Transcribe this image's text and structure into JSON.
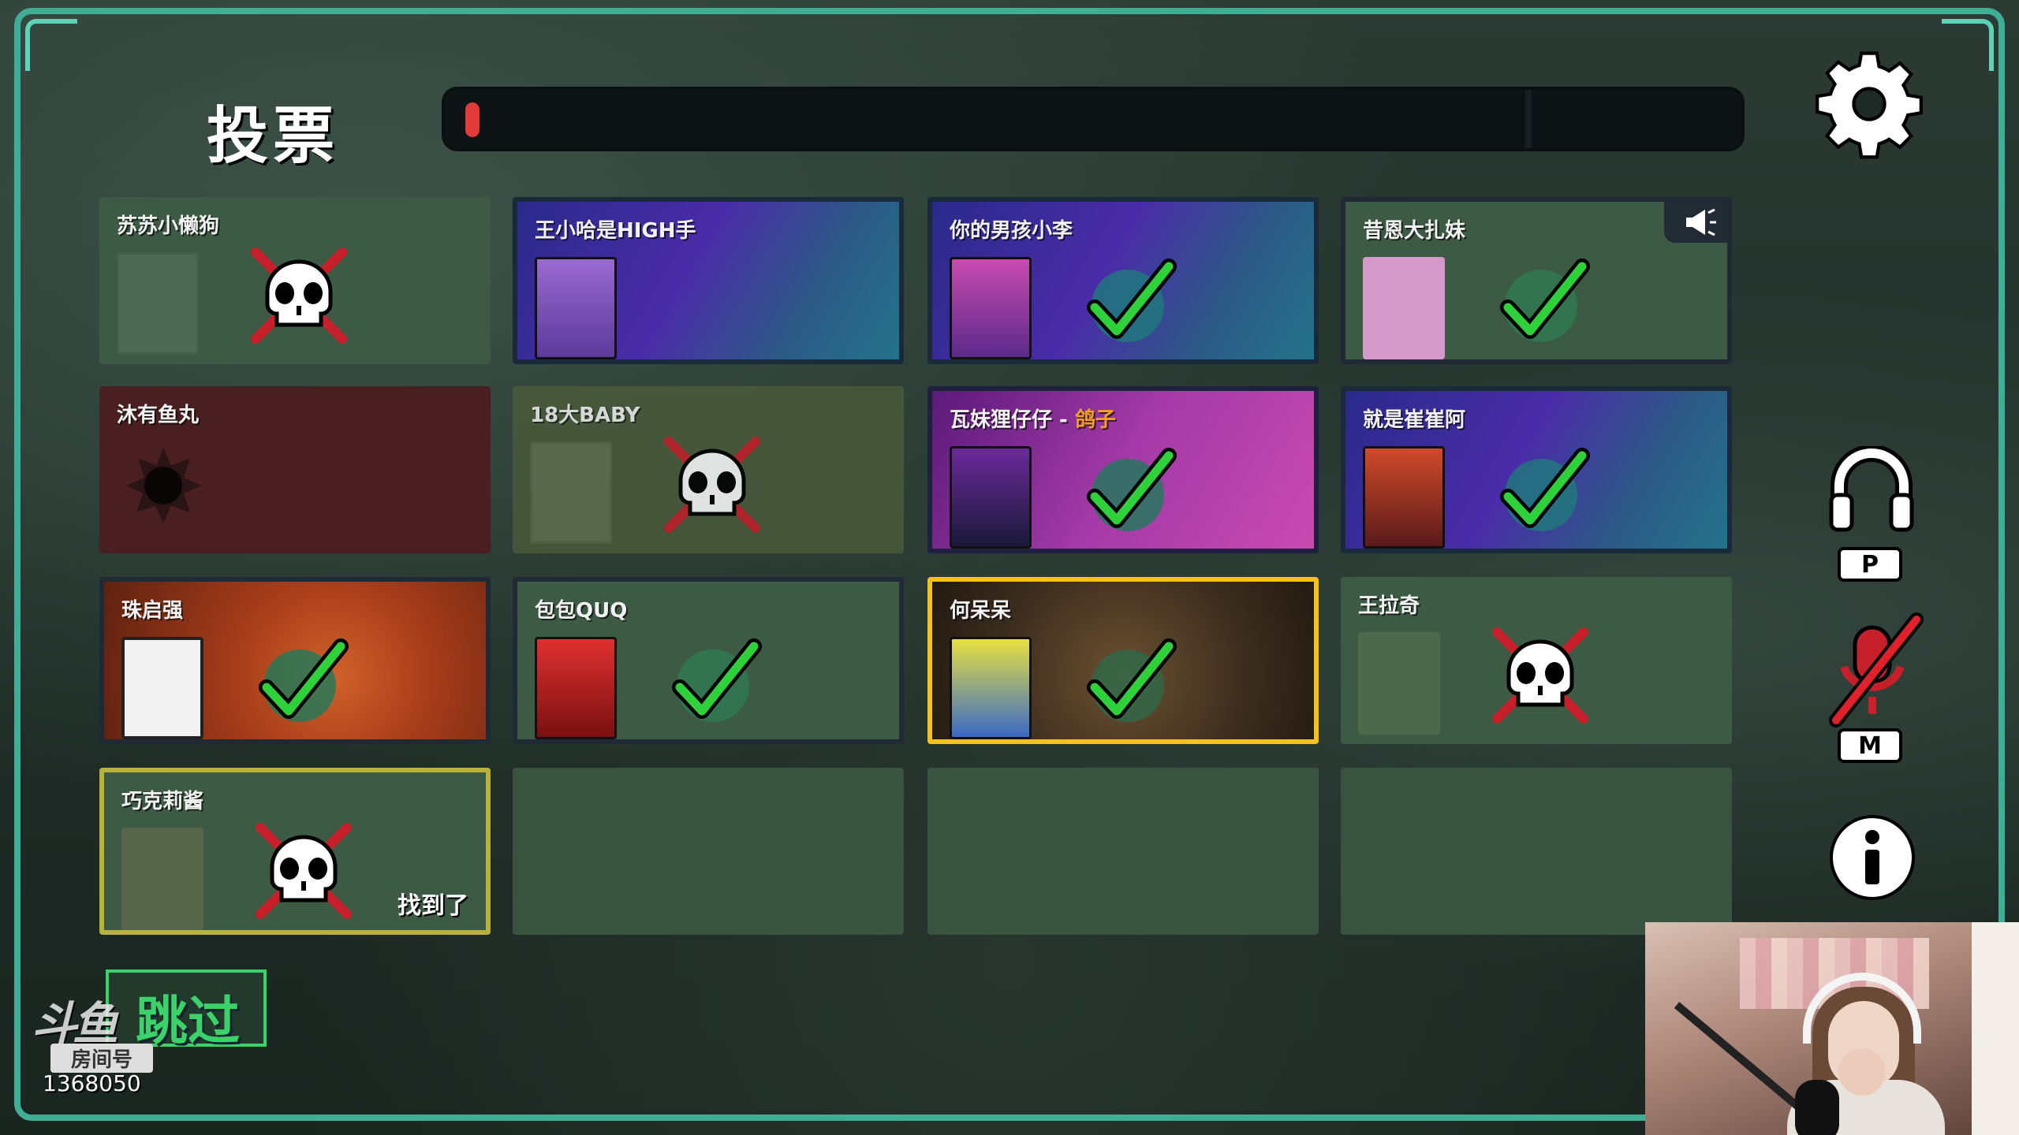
{
  "screen": {
    "title": "投票",
    "timer_progress": 0.02
  },
  "players": [
    {
      "name": "苏苏小懒狗",
      "status": "dead",
      "vote": "none"
    },
    {
      "name": "王小哈是HIGH手",
      "status": "alive",
      "vote": "voted"
    },
    {
      "name": "你的男孩小李",
      "status": "alive",
      "vote": "voted"
    },
    {
      "name": "昔恩大扎妹",
      "status": "alive",
      "vote": "voted",
      "reporter": true
    },
    {
      "name": "沐有鱼丸",
      "status": "shot",
      "vote": "none"
    },
    {
      "name": "18大BABY",
      "status": "dead",
      "vote": "none"
    },
    {
      "name": "瓦妹狸仔仔 - ",
      "role": "鸽子",
      "status": "alive",
      "vote": "voted"
    },
    {
      "name": "就是崔崔阿",
      "status": "alive",
      "vote": "voted"
    },
    {
      "name": "珠启强",
      "status": "alive",
      "vote": "voted"
    },
    {
      "name": "包包QUQ",
      "status": "alive",
      "vote": "voted"
    },
    {
      "name": "何呆呆",
      "status": "alive",
      "vote": "voted",
      "self": true
    },
    {
      "name": "王拉奇",
      "status": "dead",
      "vote": "none"
    },
    {
      "name": "巧克莉酱",
      "status": "dead",
      "vote": "none",
      "tag": "找到了"
    }
  ],
  "controls": {
    "skip_label": "跳过",
    "push_to_talk_key": "P",
    "mute_key": "M",
    "icons": [
      "gear-icon",
      "headphones-icon",
      "mic-muted-icon",
      "info-icon",
      "megaphone-icon"
    ]
  },
  "stream_overlay": {
    "logo": "斗鱼",
    "room_label": "房间号",
    "room_number": "1368050"
  },
  "colors": {
    "accent": "#3fae95",
    "skip_green": "#3bd26a",
    "vote_check": "#2fd13a",
    "dead_x": "#c8202a",
    "self_highlight": "#f5c21b",
    "role_orange": "#f0a21e"
  }
}
